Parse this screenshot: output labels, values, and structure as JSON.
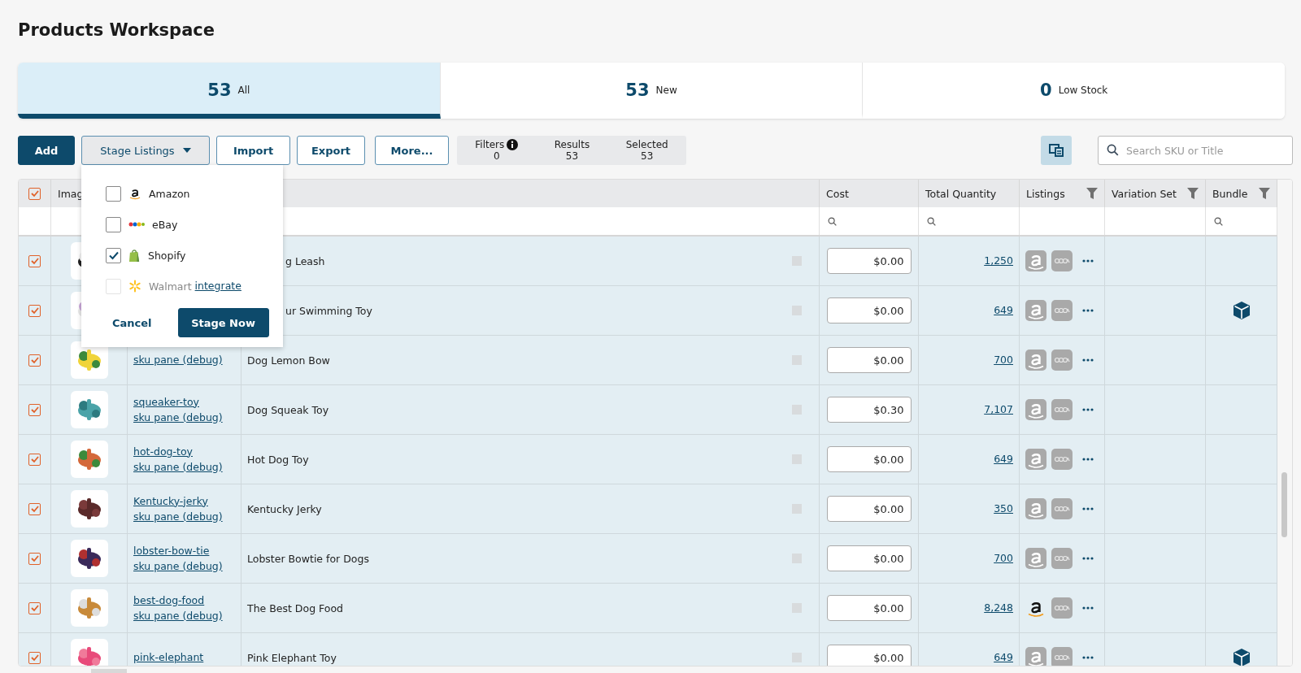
{
  "page_title": "Products Workspace",
  "tabs": [
    {
      "count": "53",
      "label": "All",
      "selected": true
    },
    {
      "count": "53",
      "label": "New",
      "selected": false
    },
    {
      "count": "0",
      "label": "Low Stock",
      "selected": false
    }
  ],
  "toolbar": {
    "add": "Add",
    "stage_listings": {
      "label": "Stage Listings",
      "expanded": true
    },
    "import": "Import",
    "export": "Export",
    "more": "More...",
    "stats": [
      {
        "label": "Filters",
        "value": "0",
        "info": true
      },
      {
        "label": "Results",
        "value": "53",
        "info": false
      },
      {
        "label": "Selected",
        "value": "53",
        "info": false
      }
    ],
    "search": {
      "placeholder": "Search SKU or Title"
    }
  },
  "stage_menu": {
    "channels": [
      {
        "kind": "amazon",
        "label": "Amazon",
        "checked": false,
        "disabled": false
      },
      {
        "kind": "ebay",
        "label": "eBay",
        "checked": false,
        "disabled": false
      },
      {
        "kind": "shopify",
        "label": "Shopify",
        "checked": true,
        "disabled": false
      },
      {
        "kind": "walmart",
        "label": "Walmart",
        "checked": false,
        "disabled": true,
        "link": "integrate"
      }
    ],
    "cancel": "Cancel",
    "confirm": "Stage Now"
  },
  "table": {
    "all_checked": true,
    "columns": [
      {
        "label": "Imag",
        "search": false
      },
      {},
      {},
      {
        "label": "Cost",
        "filter": false,
        "search": true
      },
      {
        "label": "Total Quantity",
        "filter": false,
        "search": true
      },
      {
        "label": "Listings",
        "filter": true,
        "search": false
      },
      {
        "label": "Variation Set",
        "filter": true,
        "search": false
      },
      {
        "label": "Bundle",
        "filter": true,
        "search": true
      }
    ],
    "rows": [
      {
        "checked": true,
        "title": "g Leash",
        "cost": "$0.00",
        "quantity": "1,250",
        "amazon_active": false,
        "bundle": false
      },
      {
        "checked": true,
        "title": "ur Swimming Toy",
        "cost": "$0.00",
        "quantity": "649",
        "amazon_active": false,
        "bundle": true
      },
      {
        "checked": true,
        "sku_pane": "sku pane (debug)",
        "title": "Dog Lemon Bow",
        "cost": "$0.00",
        "quantity": "700",
        "amazon_active": false,
        "bundle": false
      },
      {
        "checked": true,
        "sku": "squeaker-toy",
        "sku_pane": "sku pane (debug)",
        "title": "Dog Squeak Toy",
        "cost": "$0.30",
        "quantity": "7,107",
        "amazon_active": false,
        "bundle": false
      },
      {
        "checked": true,
        "sku": "hot-dog-toy",
        "sku_pane": "sku pane (debug)",
        "title": "Hot Dog Toy",
        "cost": "$0.00",
        "quantity": "649",
        "amazon_active": false,
        "bundle": false
      },
      {
        "checked": true,
        "sku": "Kentucky-jerky",
        "sku_pane": "sku pane (debug)",
        "title": "Kentucky Jerky",
        "cost": "$0.00",
        "quantity": "350",
        "amazon_active": false,
        "bundle": false
      },
      {
        "checked": true,
        "sku": "lobster-bow-tie",
        "sku_pane": "sku pane (debug)",
        "title": "Lobster Bowtie for Dogs",
        "cost": "$0.00",
        "quantity": "700",
        "amazon_active": false,
        "bundle": false
      },
      {
        "checked": true,
        "sku": "best-dog-food",
        "sku_pane": "sku pane (debug)",
        "title": "The Best Dog Food",
        "cost": "$0.00",
        "quantity": "8,248",
        "amazon_active": true,
        "bundle": false
      },
      {
        "checked": true,
        "sku": "pink-elephant",
        "title": "Pink Elephant Toy",
        "cost": "$0.00",
        "quantity": "649",
        "amazon_active": false,
        "bundle": true
      }
    ]
  }
}
